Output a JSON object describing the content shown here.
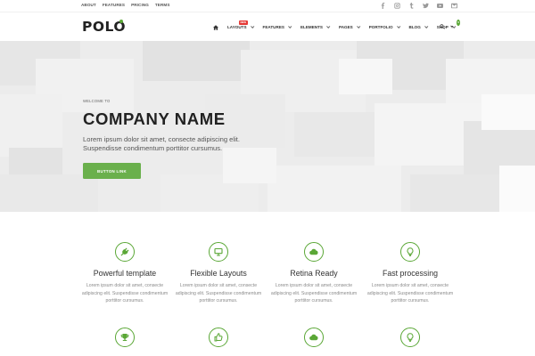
{
  "topbar": {
    "links": [
      "ABOUT",
      "FEATURES",
      "PRICING",
      "TERMS"
    ],
    "social": [
      "facebook-icon",
      "instagram-icon",
      "tumblr-icon",
      "twitter-icon",
      "youtube-icon",
      "message-icon"
    ]
  },
  "brand": {
    "logo": "POLO",
    "accent": "#5aa736"
  },
  "nav": {
    "items": [
      {
        "label": "LAYOUTS",
        "badge": "NEW"
      },
      {
        "label": "FEATURES"
      },
      {
        "label": "ELEMENTS"
      },
      {
        "label": "PAGES"
      },
      {
        "label": "PORTFOLIO"
      },
      {
        "label": "BLOG"
      },
      {
        "label": "SHOP"
      }
    ],
    "cart_count": "0"
  },
  "hero": {
    "kicker": "WELCOME TO",
    "title": "COMPANY NAME",
    "text": "Lorem ipsum dolor sit amet, consecte adipiscing elit. Suspendisse condimentum porttitor cursumus.",
    "button": "BUTTON LINK",
    "button_color": "#6ab04c"
  },
  "features": {
    "row1": [
      {
        "icon": "plug-icon",
        "title": "Powerful template",
        "text": "Lorem ipsum dolor sit amet, consecte adipiscing elit. Suspendisse condimentum porttitor cursumus."
      },
      {
        "icon": "monitor-icon",
        "title": "Flexible Layouts",
        "text": "Lorem ipsum dolor sit amet, consecte adipiscing elit. Suspendisse condimentum porttitor cursumus."
      },
      {
        "icon": "cloud-icon",
        "title": "Retina Ready",
        "text": "Lorem ipsum dolor sit amet, consecte adipiscing elit. Suspendisse condimentum porttitor cursumus."
      },
      {
        "icon": "lightbulb-icon",
        "title": "Fast processing",
        "text": "Lorem ipsum dolor sit amet, consecte adipiscing elit. Suspendisse condimentum porttitor cursumus."
      }
    ],
    "row2_icons": [
      "trophy-icon",
      "thumbs-up-icon",
      "cloud-icon",
      "lightbulb-icon"
    ]
  }
}
